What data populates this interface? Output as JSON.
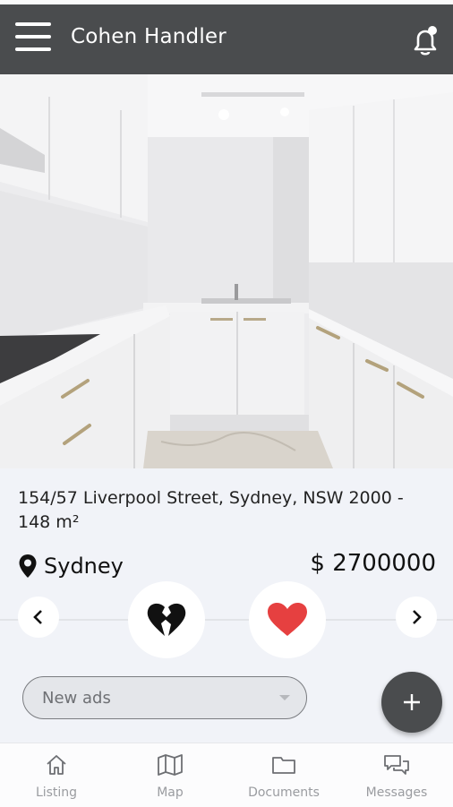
{
  "header": {
    "title": "Cohen Handler",
    "menu_icon": "hamburger-menu-icon",
    "notification_icon": "bell-with-dot-icon"
  },
  "listing": {
    "address": "154/57 Liverpool Street, Sydney, NSW 2000 - 148 m²",
    "city": "Sydney",
    "price": "$ 2700000"
  },
  "actions": {
    "prev_icon": "chevron-left-icon",
    "next_icon": "chevron-right-icon",
    "dislike_icon": "broken-heart-icon",
    "like_icon": "heart-icon"
  },
  "filter": {
    "selected": "New ads"
  },
  "bottom_nav": {
    "items": [
      {
        "label": "Listing",
        "icon": "home-icon"
      },
      {
        "label": "Map",
        "icon": "map-icon"
      },
      {
        "label": "Documents",
        "icon": "folder-icon"
      },
      {
        "label": "Messages",
        "icon": "messages-icon"
      }
    ]
  },
  "colors": {
    "header_bg": "#4a4c4e",
    "like_red": "#e64040",
    "page_bg": "#f1f3f8"
  }
}
